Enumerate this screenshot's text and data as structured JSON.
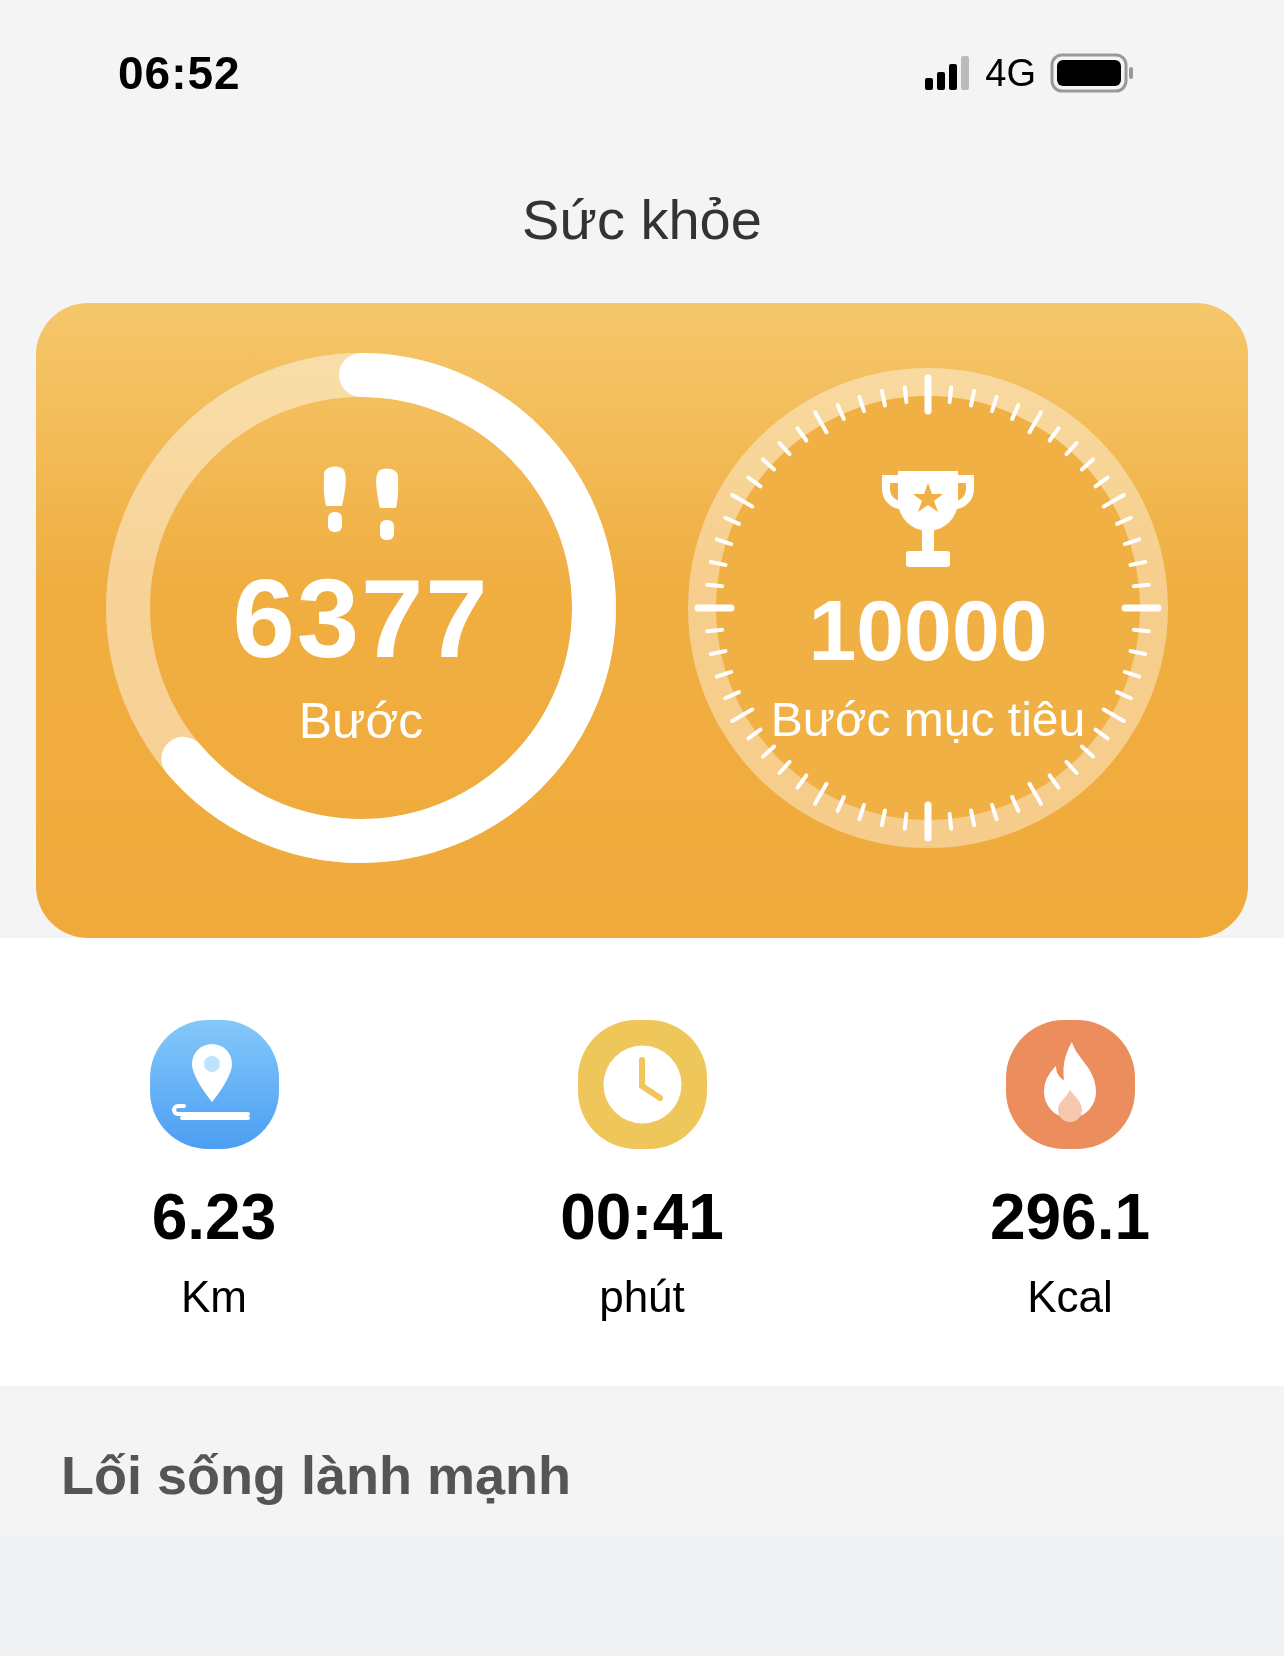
{
  "status_bar": {
    "time": "06:52",
    "network": "4G"
  },
  "title": "Sức khỏe",
  "steps": {
    "value": "6377",
    "label": "Bước",
    "level": 0.6377
  },
  "goal": {
    "value": "10000",
    "label": "Bước mục tiêu"
  },
  "stats": [
    {
      "kind": "distance",
      "value": "6.23",
      "unit": "Km"
    },
    {
      "kind": "time",
      "value": "00:41",
      "unit": "phút"
    },
    {
      "kind": "calories",
      "value": "296.1",
      "unit": "Kcal"
    }
  ],
  "section_title": "Lối sống lành mạnh"
}
